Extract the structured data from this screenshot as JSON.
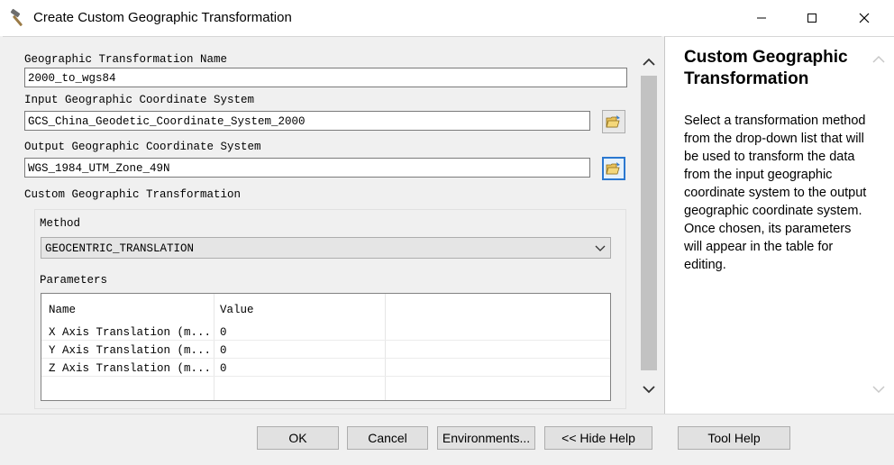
{
  "window": {
    "title": "Create Custom Geographic Transformation"
  },
  "form": {
    "name_label": "Geographic Transformation Name",
    "name_value": "2000_to_wgs84",
    "input_gcs_label": "Input Geographic Coordinate System",
    "input_gcs_value": "GCS_China_Geodetic_Coordinate_System_2000",
    "output_gcs_label": "Output Geographic Coordinate System",
    "output_gcs_value": "WGS_1984_UTM_Zone_49N",
    "custom_group_label": "Custom Geographic Transformation",
    "method_label": "Method",
    "method_value": "GEOCENTRIC_TRANSLATION",
    "parameters_label": "Parameters",
    "table": {
      "headers": [
        "Name",
        "Value"
      ],
      "rows": [
        {
          "name": "X Axis Translation (m...",
          "value": "0"
        },
        {
          "name": "Y Axis Translation (m...",
          "value": "0"
        },
        {
          "name": "Z Axis Translation (m...",
          "value": "0"
        }
      ]
    }
  },
  "help": {
    "title": "Custom Geographic Transformation",
    "body": "Select a transformation method from the drop-down list that will be used to transform the data from the input geographic coordinate system to the output geographic coordinate system. Once chosen, its parameters will appear in the table for editing."
  },
  "buttons": {
    "ok": "OK",
    "cancel": "Cancel",
    "environments": "Environments...",
    "hide_help": "<< Hide Help",
    "tool_help": "Tool Help"
  },
  "icons": {
    "app": "hammer-icon",
    "browse": "folder-open-icon"
  }
}
